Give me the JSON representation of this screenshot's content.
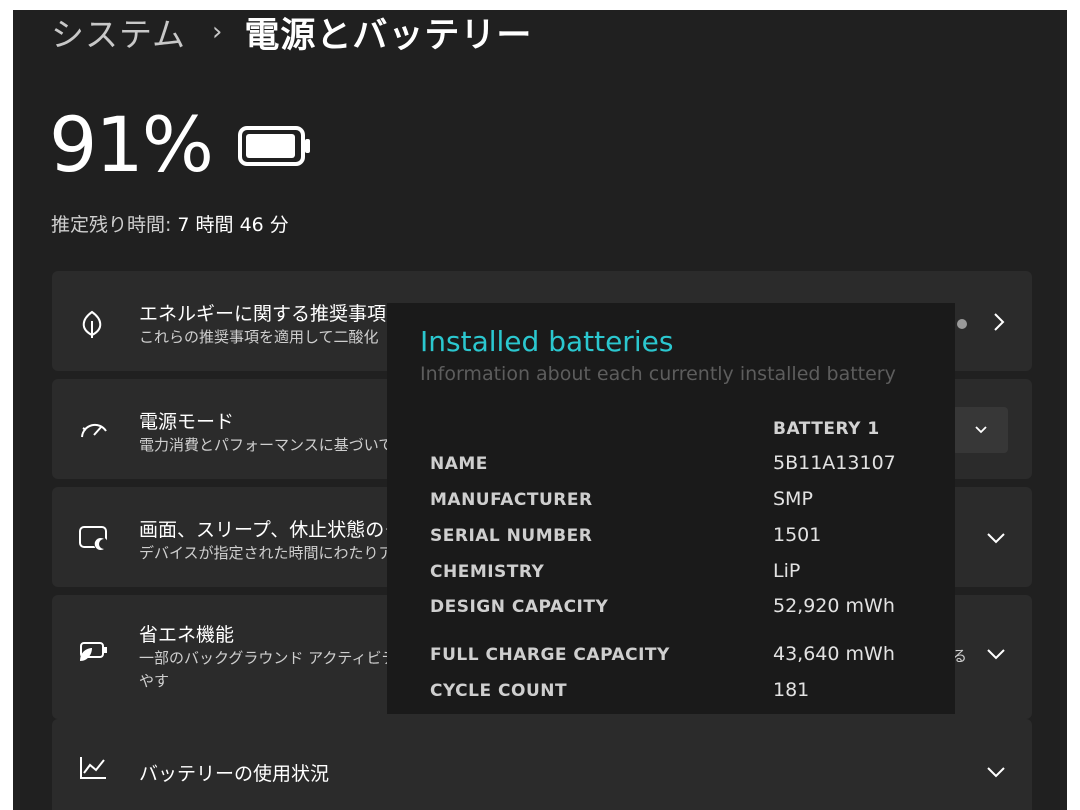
{
  "breadcrumb": {
    "parent": "システム",
    "separator": "›",
    "current": "電源とバッテリー"
  },
  "battery": {
    "percent_text": "91%",
    "level": 0.91,
    "remaining_label": "推定残り時間:",
    "remaining_value": "7 時間 46 分"
  },
  "cards": {
    "energy": {
      "icon": "leaf-icon",
      "title": "エネルギーに関する推奨事項",
      "desc": "これらの推奨事項を適用して二酸化"
    },
    "power_mode": {
      "icon": "speedometer-icon",
      "title": "電源モード",
      "desc": "電力消費とパフォーマンスに基づいて"
    },
    "screen_sleep": {
      "icon": "screen-sleep-icon",
      "title": "画面、スリープ、休止状態のタイ",
      "desc": "デバイスが指定された時間にわたりア"
    },
    "battery_saver": {
      "icon": "battery-saver-icon",
      "title": "省エネ機能",
      "desc_line1": "一部のバックグラウンド アクティビティ",
      "desc_line2": "やす",
      "tail": "る"
    },
    "usage": {
      "icon": "chart-line-icon",
      "title": "バッテリーの使用状況"
    }
  },
  "popup": {
    "title": "Installed batteries",
    "subtitle": "Information about each currently installed battery",
    "column_header": "BATTERY 1",
    "rows": [
      {
        "label": "NAME",
        "value": "5B11A13107"
      },
      {
        "label": "MANUFACTURER",
        "value": "SMP"
      },
      {
        "label": "SERIAL NUMBER",
        "value": "1501"
      },
      {
        "label": "CHEMISTRY",
        "value": "LiP"
      },
      {
        "label": "DESIGN CAPACITY",
        "value": "52,920 mWh"
      },
      {
        "label": "FULL CHARGE CAPACITY",
        "value": "43,640 mWh"
      },
      {
        "label": "CYCLE COUNT",
        "value": "181"
      }
    ]
  },
  "colors": {
    "background": "#202020",
    "card": "#2b2b2b",
    "popup_bg": "#1a1a1a",
    "accent": "#2bc7cf"
  }
}
